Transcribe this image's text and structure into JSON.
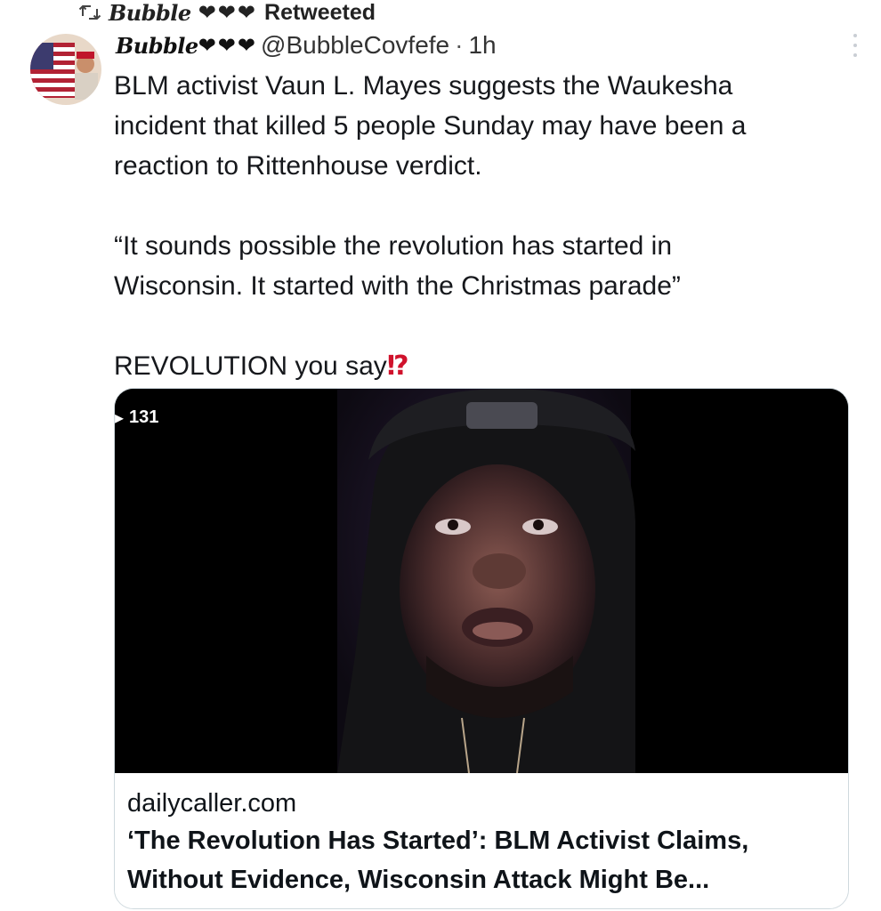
{
  "retweet": {
    "icon": "retweet-icon",
    "name_script": "Bubble",
    "hearts": "❤❤❤",
    "label": "Retweeted"
  },
  "tweet": {
    "author_script": "Bubble",
    "author_hearts": "❤❤❤",
    "handle": "@BubbleCovfefe",
    "separator": "·",
    "time": "1h",
    "text": {
      "line1": "BLM activist Vaun L. Mayes suggests the Waukesha",
      "line2": "incident that killed 5 people Sunday may have been a",
      "line3": "reaction to Rittenhouse verdict.",
      "line4": "“It sounds possible the revolution has started in",
      "line5": "Wisconsin. It started with the Christmas parade”",
      "line6": "REVOLUTION you say",
      "emoji": "⁉"
    }
  },
  "card": {
    "view_count": "131",
    "domain": "dailycaller.com",
    "title_line1": "‘The Revolution Has Started’: BLM Activist Claims,",
    "title_line2": "Without Evidence, Wisconsin Attack Might Be..."
  },
  "colors": {
    "text": "#16181c",
    "border": "#cfd9de",
    "emoji_red": "#d0122c"
  }
}
